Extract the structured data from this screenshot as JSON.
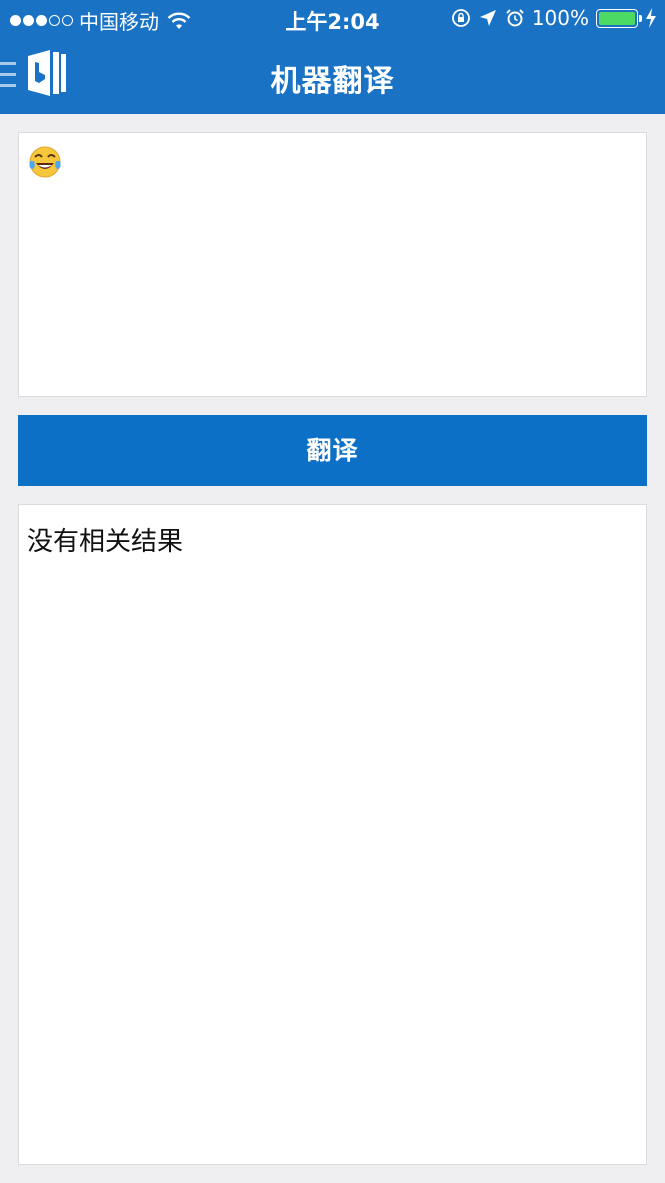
{
  "status_bar": {
    "carrier": "中国移动",
    "time": "上午2:04",
    "battery": "100%",
    "signal_icon": "signal-dots-icon",
    "wifi_icon": "wifi-icon",
    "battery_fill_fraction": 1.0
  },
  "nav": {
    "title": "机器翻译",
    "menu_icon": "hamburger-menu-icon",
    "logo_icon": "bing-translator-logo-icon"
  },
  "input": {
    "value": "😂",
    "content_icon": "face-with-tears-of-joy-emoji"
  },
  "translate_button": {
    "label": "翻译"
  },
  "result": {
    "text": "没有相关结果"
  },
  "colors": {
    "header": "#1a72c4",
    "button": "#0b70c6",
    "background": "#efeff1",
    "battery": "#4cd964"
  }
}
